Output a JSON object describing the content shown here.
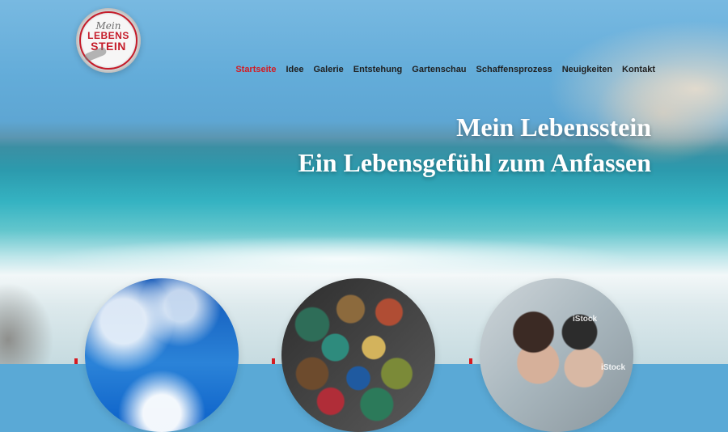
{
  "logo": {
    "line1": "Mein",
    "line2": "LEBENS",
    "line3": "STEIN"
  },
  "nav": {
    "items": [
      {
        "label": "Startseite",
        "active": true
      },
      {
        "label": "Idee",
        "active": false
      },
      {
        "label": "Galerie",
        "active": false
      },
      {
        "label": "Entstehung",
        "active": false
      },
      {
        "label": "Gartenschau",
        "active": false
      },
      {
        "label": "Schaffensprozess",
        "active": false
      },
      {
        "label": "Neuigkeiten",
        "active": false
      },
      {
        "label": "Kontakt",
        "active": false
      }
    ]
  },
  "hero": {
    "title_line1": "Mein Lebensstein",
    "title_line2": "Ein Lebensgefühl zum Anfassen"
  },
  "feature_images": [
    {
      "label": "sky"
    },
    {
      "label": "stones"
    },
    {
      "label": "people"
    }
  ],
  "watermarks": {
    "istock_1": "iStock",
    "istock_2": "iStock"
  },
  "colors": {
    "accent_red": "#d31b22",
    "nav_text": "#1f1f1f"
  }
}
